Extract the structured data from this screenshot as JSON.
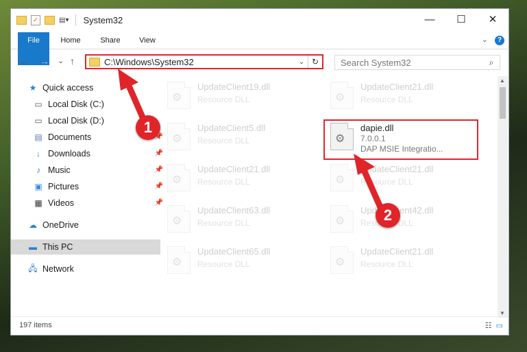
{
  "window": {
    "title": "System32"
  },
  "titlebar": {
    "minimize": "—",
    "maximize": "☐",
    "close": "✕"
  },
  "ribbon": {
    "tabs": [
      "File",
      "Home",
      "Share",
      "View"
    ],
    "help": "?"
  },
  "nav": {
    "back": "←",
    "forward": "→",
    "recent": "⌄",
    "up": "↑"
  },
  "address": {
    "path": "C:\\Windows\\System32",
    "dropdown": "⌄",
    "refresh": "↻"
  },
  "search": {
    "placeholder": "Search System32"
  },
  "sidebar": {
    "items": [
      {
        "label": "Quick access",
        "icon": "star-icon"
      },
      {
        "label": "Local Disk (C:)",
        "icon": "drive-icon"
      },
      {
        "label": "Local Disk (D:)",
        "icon": "drive-icon"
      },
      {
        "label": "Documents",
        "icon": "documents-icon"
      },
      {
        "label": "Downloads",
        "icon": "download-icon"
      },
      {
        "label": "Music",
        "icon": "music-icon"
      },
      {
        "label": "Pictures",
        "icon": "pictures-icon"
      },
      {
        "label": "Videos",
        "icon": "videos-icon"
      },
      {
        "label": "OneDrive",
        "icon": "onedrive-icon"
      },
      {
        "label": "This PC",
        "icon": "pc-icon"
      },
      {
        "label": "Network",
        "icon": "network-icon"
      }
    ]
  },
  "files": [
    {
      "name": "UpdateClient19.dll",
      "type": "Resource DLL"
    },
    {
      "name": "UpdateClient21.dll",
      "type": "Resource DLL"
    },
    {
      "name": "UpdateClient5.dll",
      "type": "Resource DLL"
    },
    {
      "name": "dapie.dll",
      "version": "7.0.0.1",
      "description": "DAP MSIE Integratio..."
    },
    {
      "name": "UpdateClient21.dll",
      "type": "Resource DLL"
    },
    {
      "name": "UpdateClient21.dll",
      "type": "Resource DLL"
    },
    {
      "name": "UpdateClient63.dll",
      "type": "Resource DLL"
    },
    {
      "name": "UpdateClient42.dll",
      "type": "Resource DLL"
    },
    {
      "name": "UpdateClient65.dll",
      "type": "Resource DLL"
    },
    {
      "name": "UpdateClient21.dll",
      "type": "Resource DLL"
    }
  ],
  "annotations": {
    "step1": "1",
    "step2": "2",
    "color": "#e0252a"
  },
  "status": {
    "item_count": "197 items"
  },
  "colors": {
    "accent": "#1979ca",
    "highlight": "#e0252a"
  }
}
